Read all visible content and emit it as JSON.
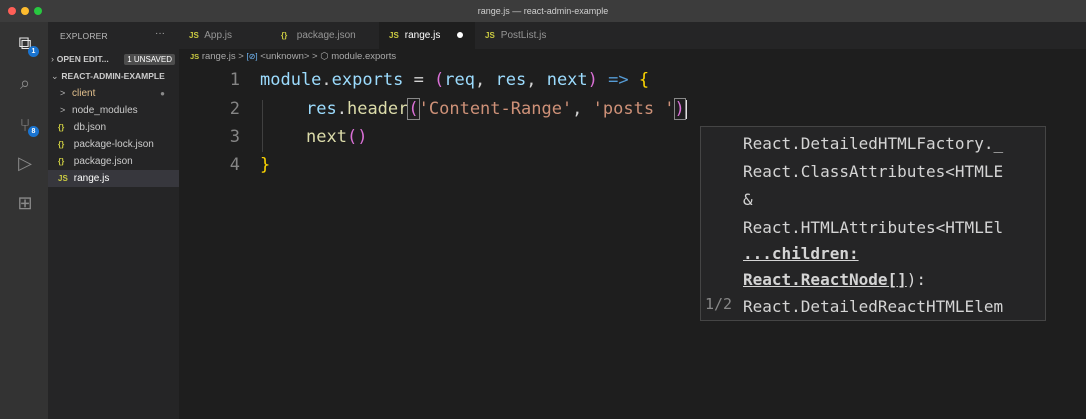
{
  "window": {
    "title": "range.js — react-admin-example",
    "traffic_lights": [
      "#ff5f57",
      "#febc2e",
      "#28c840"
    ]
  },
  "activity_bar": {
    "items": [
      {
        "icon": "files-icon",
        "glyph": "⧉",
        "badge": "1"
      },
      {
        "icon": "search-icon",
        "glyph": "⌕",
        "badge": ""
      },
      {
        "icon": "source-control-icon",
        "glyph": "⑂",
        "badge": "8"
      },
      {
        "icon": "run-debug-icon",
        "glyph": "▷",
        "badge": ""
      },
      {
        "icon": "extensions-icon",
        "glyph": "⊞",
        "badge": ""
      }
    ],
    "badge_color": "#1a74d0"
  },
  "sidebar": {
    "header": "EXPLORER",
    "menu": "···",
    "open_editors": {
      "label": "OPEN EDIT...",
      "badge": "1 UNSAVED"
    },
    "project": {
      "label": "REACT-ADMIN-EXAMPLE"
    },
    "items": [
      {
        "label": "client",
        "chev": ">",
        "icon": "",
        "modified": "●"
      },
      {
        "label": "node_modules",
        "chev": ">",
        "icon": ""
      },
      {
        "label": "db.json",
        "chev": "",
        "icon": "{}"
      },
      {
        "label": "package-lock.json",
        "chev": "",
        "icon": "{}"
      },
      {
        "label": "package.json",
        "chev": "",
        "icon": "{}"
      },
      {
        "label": "range.js",
        "chev": "",
        "icon": "JS"
      }
    ]
  },
  "tabs": [
    {
      "icon": "JS",
      "label": "App.js"
    },
    {
      "icon": "{}",
      "label": "package.json"
    },
    {
      "icon": "JS",
      "label": "range.js",
      "dirty": true
    },
    {
      "icon": "JS",
      "label": "PostList.js"
    }
  ],
  "breadcrumb": {
    "file_icon": "JS",
    "file": "range.js",
    "sep": ">",
    "scope_icon": "[⊘]",
    "scope": "<unknown>",
    "member_icon": "⬡",
    "member": "module.exports"
  },
  "editor": {
    "line_numbers": [
      "1",
      "2",
      "3",
      "4"
    ],
    "line1": {
      "a": "module",
      "b": ".",
      "c": "exports",
      "d": " = ",
      "e": "(",
      "f": "req",
      "g": ", ",
      "h": "res",
      "i": ", ",
      "j": "next",
      "k": ")",
      "l": " => ",
      "m": "{"
    },
    "line2": {
      "a": "res",
      "b": ".",
      "c": "header",
      "d": "(",
      "e": "'Content-Range'",
      "f": ", ",
      "g": "'posts '",
      "h": ")"
    },
    "line3": {
      "a": "next",
      "b": "()"
    },
    "line4": {
      "a": "}"
    }
  },
  "parameter_hint": {
    "lines": [
      "React.DetailedHTMLFactory._",
      "React.ClassAttributes<HTMLE",
      "&",
      "React.HTMLAttributes<HTMLEl",
      "...children:",
      "React.ReactNode[]",
      "React.DetailedReactHTMLElem"
    ],
    "after_bold": "):",
    "counter": "1/2"
  }
}
